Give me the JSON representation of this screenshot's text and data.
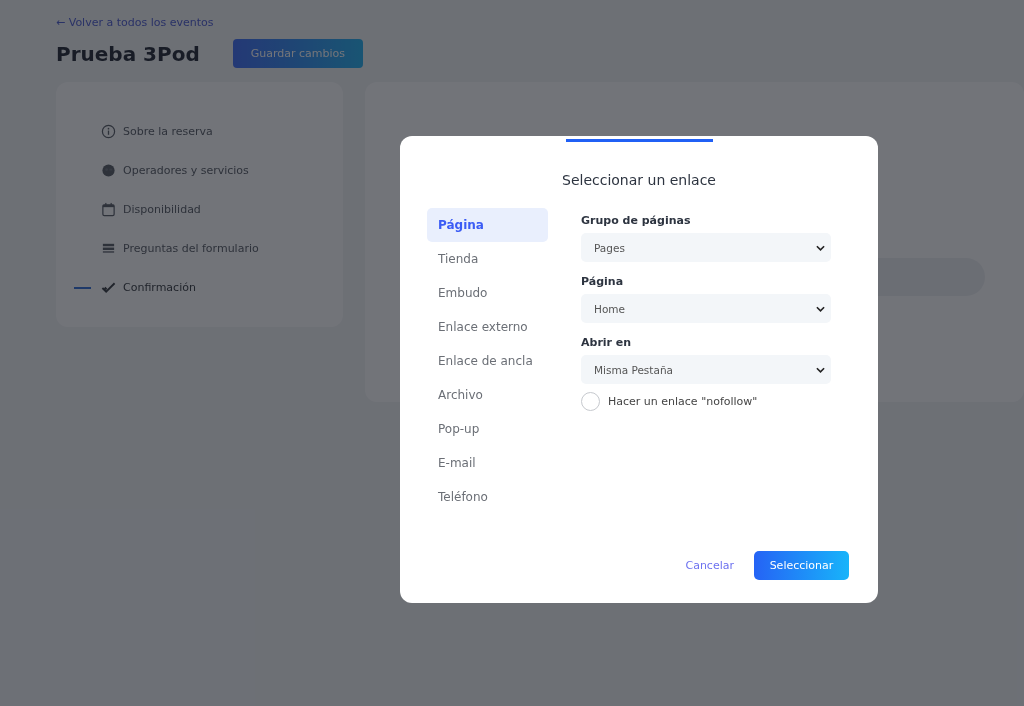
{
  "back_link": "← Volver a todos los eventos",
  "title": "Prueba 3Pod",
  "save_button": "Guardar cambios",
  "steps": [
    {
      "label": "Sobre la reserva",
      "active": false
    },
    {
      "label": "Operadores y servicios",
      "active": false
    },
    {
      "label": "Disponibilidad",
      "active": false
    },
    {
      "label": "Preguntas del formulario",
      "active": false
    },
    {
      "label": "Confirmación",
      "active": true
    }
  ],
  "modal": {
    "title": "Seleccionar un enlace",
    "link_types": [
      {
        "label": "Página",
        "selected": true
      },
      {
        "label": "Tienda",
        "selected": false
      },
      {
        "label": "Embudo",
        "selected": false
      },
      {
        "label": "Enlace externo",
        "selected": false
      },
      {
        "label": "Enlace de ancla",
        "selected": false
      },
      {
        "label": "Archivo",
        "selected": false
      },
      {
        "label": "Pop-up",
        "selected": false
      },
      {
        "label": "E-mail",
        "selected": false
      },
      {
        "label": "Teléfono",
        "selected": false
      }
    ],
    "fields": [
      {
        "label": "Grupo de páginas",
        "value": "Pages"
      },
      {
        "label": "Página",
        "value": "Home"
      },
      {
        "label": "Abrir en",
        "value": "Misma Pestaña"
      }
    ],
    "nofollow": {
      "label": "Hacer un enlace \"nofollow\"",
      "checked": false
    },
    "cancel_button": "Cancelar",
    "select_button": "Seleccionar"
  }
}
